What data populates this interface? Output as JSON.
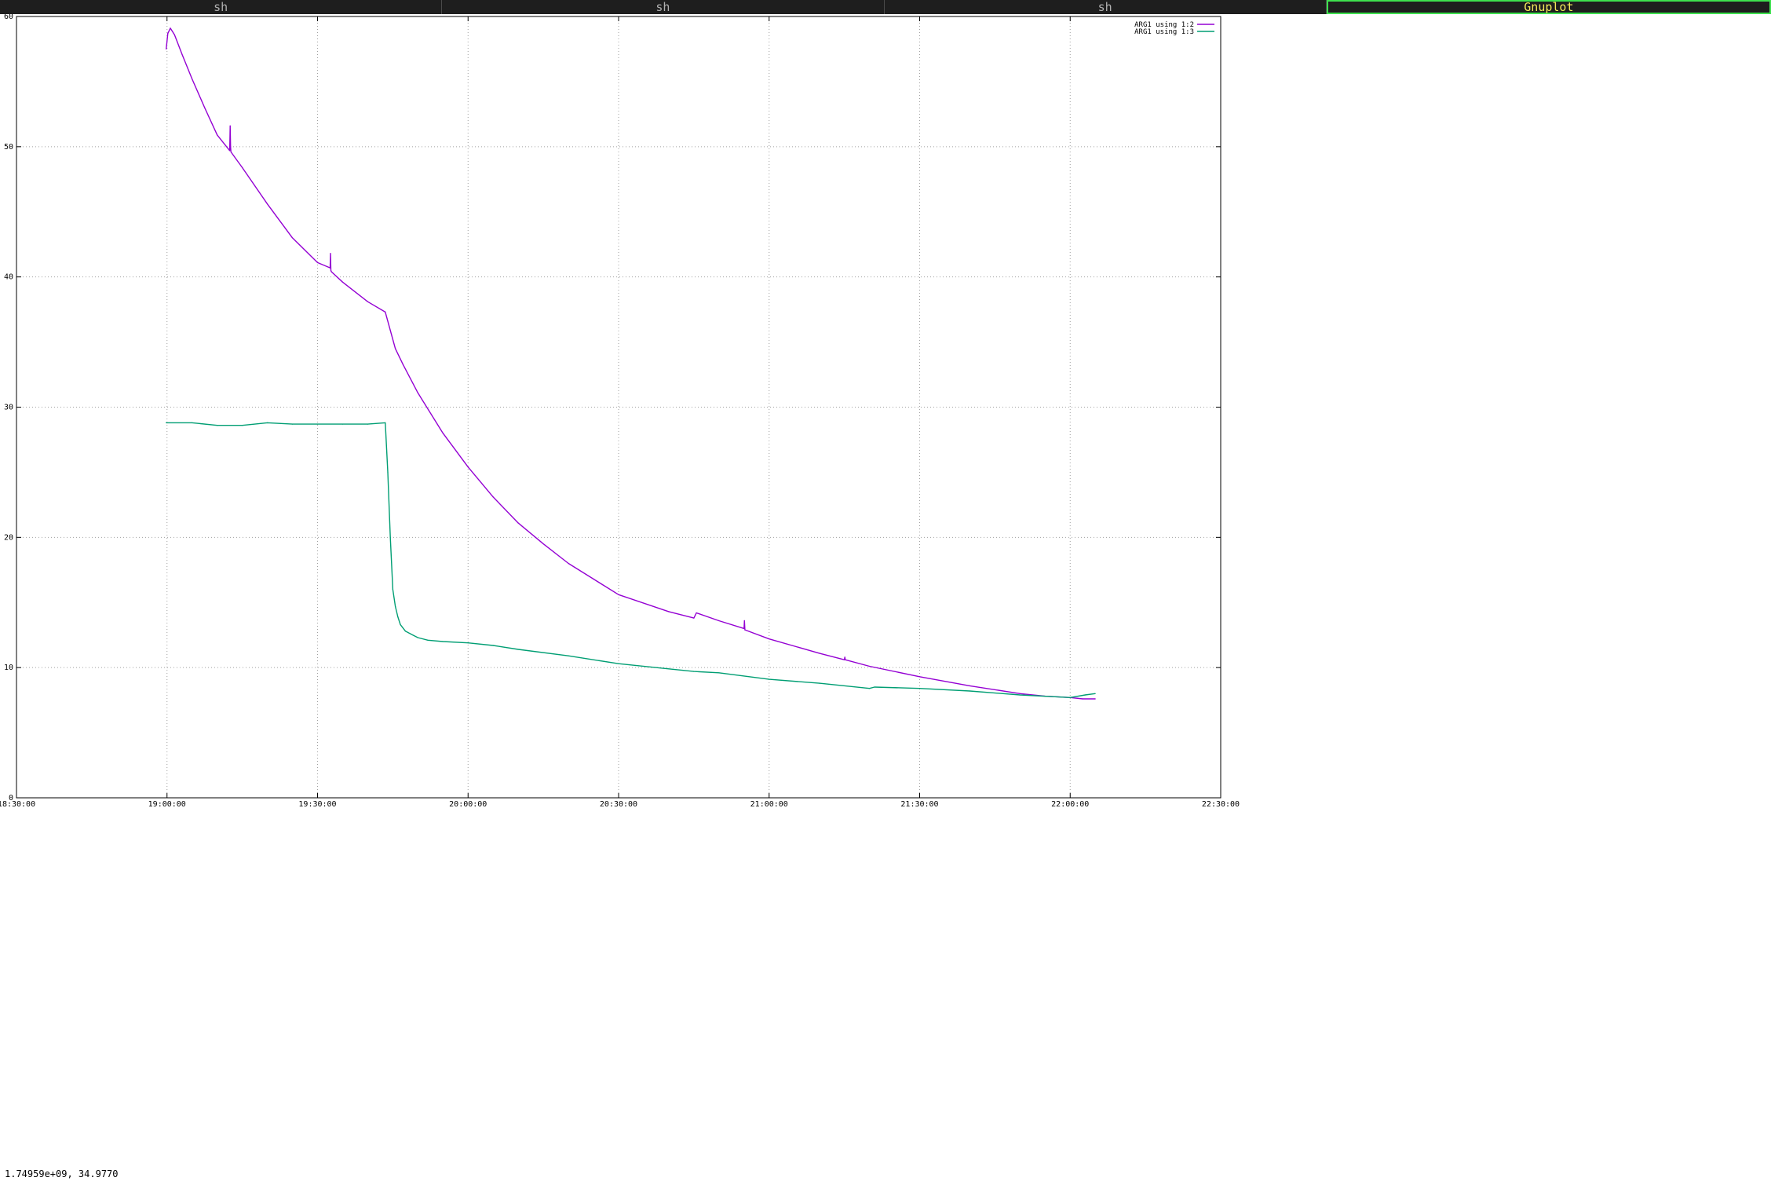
{
  "tabs": [
    {
      "label": "sh",
      "active": false
    },
    {
      "label": "sh",
      "active": false
    },
    {
      "label": "sh",
      "active": false
    },
    {
      "label": "Gnuplot",
      "active": true
    }
  ],
  "status": {
    "mouse_coordinates": "1.74959e+09,  34.9770"
  },
  "colors": {
    "series_1": "#9400d3",
    "series_2": "#009e73",
    "grid": "#a0a0a0",
    "axis": "#000000",
    "tab_bar_bg": "#1e1e1e",
    "tab_active_text": "#f2e85a",
    "tab_active_border": "#3ee04e"
  },
  "chart_data": {
    "type": "line",
    "title": "",
    "xlabel": "",
    "ylabel": "",
    "xlim": [
      "18:30:00",
      "22:30:00"
    ],
    "ylim": [
      0,
      60
    ],
    "x_ticks": [
      "18:30:00",
      "19:00:00",
      "19:30:00",
      "20:00:00",
      "20:30:00",
      "21:00:00",
      "21:30:00",
      "22:00:00",
      "22:30:00"
    ],
    "y_ticks": [
      "0",
      "10",
      "20",
      "30",
      "40",
      "50",
      "60"
    ],
    "grid": true,
    "legend_position": "top-right",
    "series": [
      {
        "name": "ARG1 using 1:2",
        "color": "#9400d3",
        "x": [
          "18:59:50",
          "19:00:10",
          "19:00:40",
          "19:01:30",
          "19:03:00",
          "19:05:00",
          "19:07:30",
          "19:10:00",
          "19:12:30",
          "19:12:35",
          "19:12:40",
          "19:12:45",
          "19:15:00",
          "19:20:00",
          "19:25:00",
          "19:30:00",
          "19:32:30",
          "19:32:35",
          "19:32:40",
          "19:32:45",
          "19:35:00",
          "19:40:00",
          "19:43:30",
          "19:44:30",
          "19:45:30",
          "19:47:00",
          "19:50:00",
          "19:55:00",
          "20:00:00",
          "20:05:00",
          "20:10:00",
          "20:15:00",
          "20:20:00",
          "20:25:00",
          "20:30:00",
          "20:40:00",
          "20:45:00",
          "20:45:30",
          "20:50:00",
          "20:55:00",
          "20:55:05",
          "20:55:10",
          "21:00:00",
          "21:10:00",
          "21:15:00",
          "21:15:05",
          "21:15:10",
          "21:20:00",
          "21:30:00",
          "21:40:00",
          "21:50:00",
          "21:55:00",
          "22:00:00",
          "22:02:30",
          "22:05:00"
        ],
        "y": [
          57.5,
          58.7,
          59.1,
          58.6,
          57.1,
          55.2,
          53.0,
          50.9,
          49.7,
          51.6,
          50.0,
          49.6,
          48.4,
          45.6,
          43.0,
          41.1,
          40.7,
          41.8,
          40.5,
          40.4,
          39.6,
          38.1,
          37.3,
          35.9,
          34.5,
          33.3,
          31.1,
          28.0,
          25.4,
          23.1,
          21.1,
          19.5,
          18.0,
          16.8,
          15.6,
          14.3,
          13.8,
          14.2,
          13.6,
          13.0,
          13.6,
          12.9,
          12.2,
          11.1,
          10.6,
          10.8,
          10.6,
          10.1,
          9.3,
          8.6,
          8.0,
          7.8,
          7.7,
          7.6,
          7.6
        ]
      },
      {
        "name": "ARG1 using 1:3",
        "color": "#009e73",
        "x": [
          "18:59:50",
          "19:05:00",
          "19:10:00",
          "19:15:00",
          "19:20:00",
          "19:25:00",
          "19:30:00",
          "19:35:00",
          "19:40:00",
          "19:43:30",
          "19:44:00",
          "19:44:30",
          "19:45:00",
          "19:45:30",
          "19:46:00",
          "19:46:30",
          "19:47:30",
          "19:49:00",
          "19:50:00",
          "19:52:00",
          "19:55:00",
          "20:00:00",
          "20:05:00",
          "20:10:00",
          "20:20:00",
          "20:30:00",
          "20:40:00",
          "20:45:00",
          "20:50:00",
          "21:00:00",
          "21:10:00",
          "21:20:00",
          "21:21:00",
          "21:30:00",
          "21:40:00",
          "21:50:00",
          "22:00:00",
          "22:03:00",
          "22:05:00"
        ],
        "y": [
          28.8,
          28.8,
          28.6,
          28.6,
          28.8,
          28.7,
          28.7,
          28.7,
          28.7,
          28.8,
          25.0,
          20.0,
          16.0,
          14.7,
          13.9,
          13.3,
          12.8,
          12.5,
          12.3,
          12.1,
          12.0,
          11.9,
          11.7,
          11.4,
          10.9,
          10.3,
          9.9,
          9.7,
          9.6,
          9.1,
          8.8,
          8.4,
          8.5,
          8.4,
          8.2,
          7.9,
          7.7,
          7.9,
          8.0
        ]
      }
    ]
  }
}
